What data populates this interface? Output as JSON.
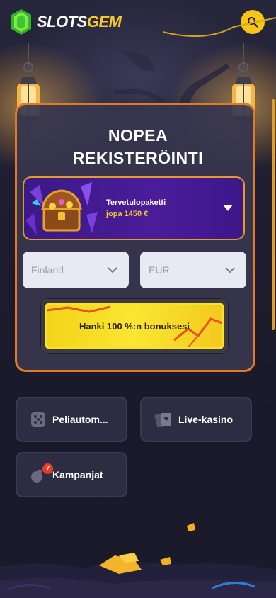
{
  "header": {
    "logo_part1": "SLOTS",
    "logo_part2": "GEM"
  },
  "registration": {
    "title_line1": "NOPEA",
    "title_line2": "REKISTERÖINTI",
    "bonus": {
      "title": "Tervetulopaketti",
      "subtitle": "jopa 1450 €"
    },
    "country_placeholder": "Finland",
    "currency_placeholder": "EUR",
    "cta_label": "Hanki 100 %:n bonuksesi"
  },
  "categories": [
    {
      "label": "Peliautom...",
      "icon": "dice-icon"
    },
    {
      "label": "Live-kasino",
      "icon": "cards-icon"
    },
    {
      "label": "Kampanjat",
      "icon": "bomb-icon",
      "badge": "7"
    }
  ],
  "colors": {
    "accent": "#f5c518",
    "panel_border": "#e07a25",
    "bonus_bg": "#4a1c9a",
    "badge": "#e53d2a"
  }
}
